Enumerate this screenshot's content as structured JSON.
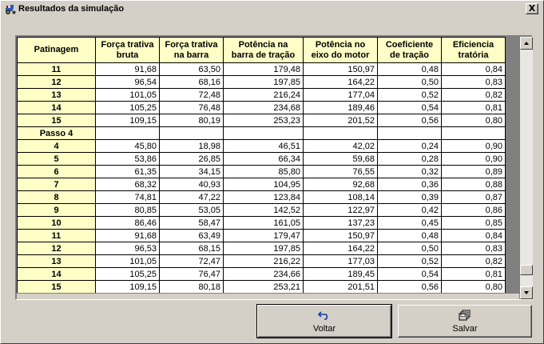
{
  "window": {
    "title": "Resultados da simulação",
    "close_glyph": "X",
    "title_icon": "tractor-icon"
  },
  "table": {
    "columns": [
      [
        "Patinagem"
      ],
      [
        "Força trativa",
        "bruta"
      ],
      [
        "Força trativa",
        "na barra"
      ],
      [
        "Potência na",
        "barra de tração"
      ],
      [
        "Potência no",
        "eixo do motor"
      ],
      [
        "Coeficiente",
        "de tração"
      ],
      [
        "Eficiencia",
        "tratória"
      ]
    ],
    "rows": [
      [
        "11",
        "91,68",
        "63,50",
        "179,48",
        "150,97",
        "0,48",
        "0,84"
      ],
      [
        "12",
        "96,54",
        "68,16",
        "197,85",
        "164,22",
        "0,50",
        "0,83"
      ],
      [
        "13",
        "101,05",
        "72,48",
        "216,24",
        "177,04",
        "0,52",
        "0,82"
      ],
      [
        "14",
        "105,25",
        "76,48",
        "234,68",
        "189,46",
        "0,54",
        "0,81"
      ],
      [
        "15",
        "109,15",
        "80,19",
        "253,23",
        "201,52",
        "0,56",
        "0,80"
      ],
      [
        "Passo 4",
        "",
        "",
        "",
        "",
        "",
        ""
      ],
      [
        "4",
        "45,80",
        "18,98",
        "46,51",
        "42,02",
        "0,24",
        "0,90"
      ],
      [
        "5",
        "53,86",
        "26,85",
        "66,34",
        "59,68",
        "0,28",
        "0,90"
      ],
      [
        "6",
        "61,35",
        "34,15",
        "85,80",
        "76,55",
        "0,32",
        "0,89"
      ],
      [
        "7",
        "68,32",
        "40,93",
        "104,95",
        "92,68",
        "0,36",
        "0,88"
      ],
      [
        "8",
        "74,81",
        "47,22",
        "123,84",
        "108,14",
        "0,39",
        "0,87"
      ],
      [
        "9",
        "80,85",
        "53,05",
        "142,52",
        "122,97",
        "0,42",
        "0,86"
      ],
      [
        "10",
        "86,46",
        "58,47",
        "161,05",
        "137,23",
        "0,45",
        "0,85"
      ],
      [
        "11",
        "91,68",
        "63,49",
        "179,47",
        "150,97",
        "0,48",
        "0,84"
      ],
      [
        "12",
        "96,53",
        "68,15",
        "197,85",
        "164,22",
        "0,50",
        "0,83"
      ],
      [
        "13",
        "101,05",
        "72,47",
        "216,22",
        "177,03",
        "0,52",
        "0,82"
      ],
      [
        "14",
        "105,25",
        "76,47",
        "234,66",
        "189,45",
        "0,54",
        "0,81"
      ],
      [
        "15",
        "109,15",
        "80,18",
        "253,21",
        "201,51",
        "0,56",
        "0,80"
      ]
    ],
    "header_bg": "#fffec7"
  },
  "buttons": {
    "voltar": {
      "label": "Voltar",
      "icon": "undo-arrow-icon"
    },
    "salvar": {
      "label": "Salvar",
      "icon": "save-disks-icon"
    }
  },
  "scrollbar": {
    "position_fraction": 0.95
  }
}
